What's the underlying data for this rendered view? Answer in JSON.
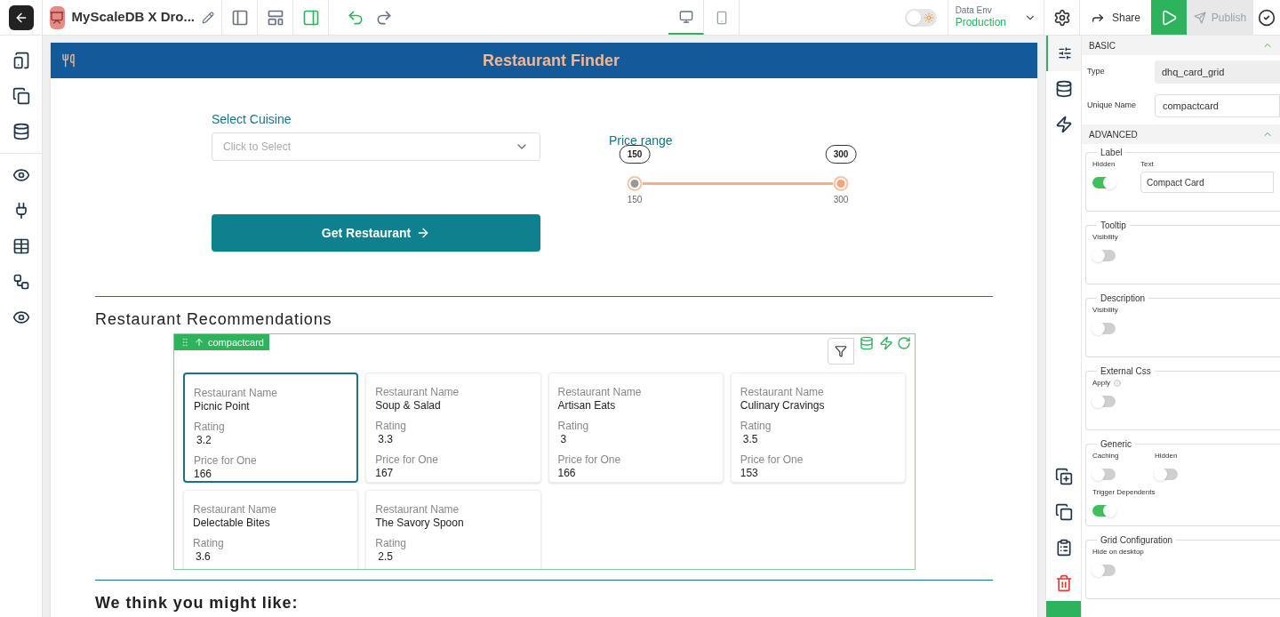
{
  "topbar": {
    "app_title": "MyScaleDB X Dro...",
    "devices": [
      {
        "kind": "desktop",
        "selected": true
      },
      {
        "kind": "mobile",
        "selected": false
      }
    ],
    "theme_toggle": {
      "on": false
    },
    "env": {
      "label": "Data Env",
      "value": "Production"
    },
    "share": "Share",
    "publish": {
      "label": "Publish",
      "disabled": true
    }
  },
  "app": {
    "title": "Restaurant Finder",
    "cuisine": {
      "label": "Select Cuisine",
      "placeholder": "Click to Select"
    },
    "button": "Get Restaurant",
    "price": {
      "label": "Price range",
      "level": 1,
      "thumbs": [
        {
          "bubble": "150",
          "tick": "150"
        },
        {
          "bubble": "300",
          "tick": "300"
        }
      ]
    },
    "section_title": "Restaurant Recommendations",
    "widget_tag": "compactcard",
    "cards": [
      {
        "selected": true,
        "fields": [
          {
            "label": "Restaurant Name",
            "value": "Picnic Point"
          },
          {
            "label": "Rating",
            "value": "3.2"
          },
          {
            "label": "Price for One",
            "value": "166"
          }
        ]
      },
      {
        "selected": false,
        "fields": [
          {
            "label": "Restaurant Name",
            "value": "Soup & Salad"
          },
          {
            "label": "Rating",
            "value": "3.3"
          },
          {
            "label": "Price for One",
            "value": "167"
          }
        ]
      },
      {
        "selected": false,
        "fields": [
          {
            "label": "Restaurant Name",
            "value": "Artisan Eats"
          },
          {
            "label": "Rating",
            "value": "3"
          },
          {
            "label": "Price for One",
            "value": "166"
          }
        ]
      },
      {
        "selected": false,
        "fields": [
          {
            "label": "Restaurant Name",
            "value": "Culinary Cravings"
          },
          {
            "label": "Rating",
            "value": "3.5"
          },
          {
            "label": "Price for One",
            "value": "153"
          }
        ]
      },
      {
        "selected": false,
        "fields": [
          {
            "label": "Restaurant Name",
            "value": "Delectable Bites"
          },
          {
            "label": "Rating",
            "value": "3.6"
          }
        ]
      },
      {
        "selected": false,
        "fields": [
          {
            "label": "Restaurant Name",
            "value": "The Savory Spoon"
          },
          {
            "label": "Rating",
            "value": "2.5"
          }
        ]
      }
    ],
    "footer_title": "We think you might like:"
  },
  "panel": {
    "basic": {
      "title": "BASIC",
      "fields": [
        {
          "label": "Type",
          "value": "dhq_card_grid",
          "kind": "readonly"
        },
        {
          "label": "Unique Name",
          "value": "compactcard",
          "kind": "input"
        }
      ]
    },
    "advanced": {
      "title": "ADVANCED",
      "groups": [
        {
          "title": "Label",
          "toggles": [
            {
              "label": "Hidden",
              "on": true
            }
          ],
          "text_field": {
            "label": "Text",
            "value": "Compact Card"
          }
        },
        {
          "title": "Tooltip",
          "toggles": [
            {
              "label": "Visibility",
              "on": false
            }
          ]
        },
        {
          "title": "Description",
          "toggles": [
            {
              "label": "Visibility",
              "on": false
            }
          ]
        },
        {
          "title": "External Css",
          "toggles": [
            {
              "label": "Apply",
              "on": false,
              "info": true
            }
          ]
        },
        {
          "title": "Generic",
          "toggles": [
            {
              "label": "Caching",
              "on": false
            },
            {
              "label": "Hidden",
              "on": false
            },
            {
              "label": "Trigger Dependents",
              "on": true
            }
          ]
        },
        {
          "title": "Grid Configuration",
          "toggles": [
            {
              "label": "Hide on desktop",
              "on": false
            }
          ]
        }
      ]
    }
  }
}
